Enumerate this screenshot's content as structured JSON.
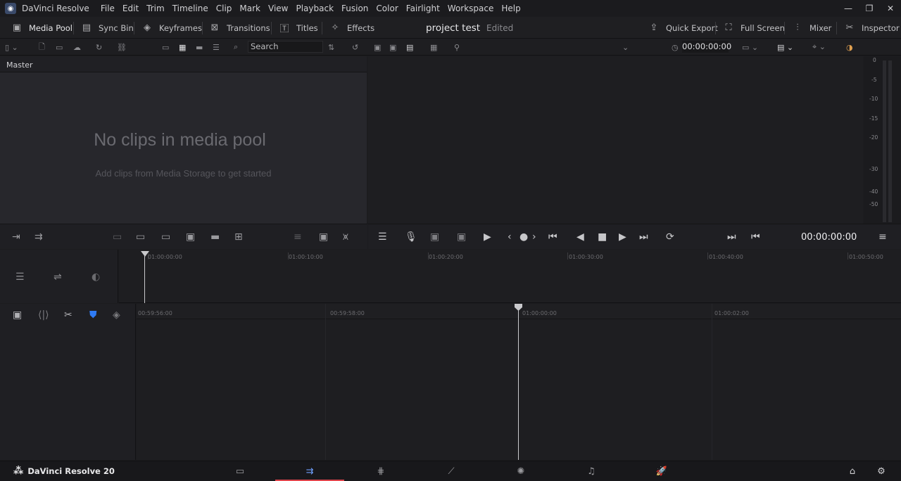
{
  "app": {
    "title": "DaVinci Resolve",
    "logo_icon": "davinci-logo-icon"
  },
  "menu": [
    "File",
    "Edit",
    "Trim",
    "Timeline",
    "Clip",
    "Mark",
    "View",
    "Playback",
    "Fusion",
    "Color",
    "Fairlight",
    "Workspace",
    "Help"
  ],
  "window_controls": {
    "minimize": "—",
    "maximize": "❐",
    "close": "✕"
  },
  "toolbar": {
    "left": [
      {
        "label": "Media Pool",
        "icon": "media-pool-icon"
      },
      {
        "label": "Sync Bin",
        "icon": "sync-bin-icon"
      },
      {
        "label": "Keyframes",
        "icon": "keyframes-icon"
      },
      {
        "label": "Transitions",
        "icon": "transitions-icon"
      },
      {
        "label": "Titles",
        "icon": "titles-icon"
      },
      {
        "label": "Effects",
        "icon": "effects-icon"
      }
    ],
    "project_title": "project test",
    "project_status": "Edited",
    "right": [
      {
        "label": "Quick Export",
        "icon": "quick-export-icon"
      },
      {
        "label": "Full Screen",
        "icon": "full-screen-icon"
      },
      {
        "label": "Mixer",
        "icon": "mixer-icon"
      },
      {
        "label": "Inspector",
        "icon": "inspector-icon"
      }
    ]
  },
  "media_pool": {
    "search_placeholder": "Search",
    "bin": "Master",
    "empty_title": "No clips in media pool",
    "empty_subtitle": "Add clips from Media Storage to get started"
  },
  "viewer": {
    "timecode": "00:00:00:00"
  },
  "audio_meter": {
    "ticks": [
      "0",
      "-5",
      "-10",
      "-15",
      "-20",
      "-30",
      "-40",
      "-50"
    ]
  },
  "transport": {
    "timecode": "00:00:00:00"
  },
  "timeline_upper": {
    "ruler": [
      "01:00:00:00",
      "01:00:10:00",
      "01:00:20:00",
      "01:00:30:00",
      "01:00:40:00",
      "01:00:50:00"
    ]
  },
  "timeline_lower": {
    "ruler": [
      "00:59:56:00",
      "00:59:58:00",
      "01:00:00:00",
      "01:00:02:00"
    ]
  },
  "footer": {
    "brand": "DaVinci Resolve 20"
  },
  "pages": [
    {
      "name": "media",
      "icon": "media-page-icon",
      "active": false
    },
    {
      "name": "cut",
      "icon": "cut-page-icon",
      "active": true
    },
    {
      "name": "edit",
      "icon": "edit-page-icon",
      "active": false
    },
    {
      "name": "fusion",
      "icon": "fusion-page-icon",
      "active": false
    },
    {
      "name": "color",
      "icon": "color-page-icon",
      "active": false
    },
    {
      "name": "fairlight",
      "icon": "fairlight-page-icon",
      "active": false
    },
    {
      "name": "deliver",
      "icon": "deliver-page-icon",
      "active": false
    }
  ],
  "colors": {
    "accent": "#6fa0ff",
    "active_underline": "#e0454b",
    "shield": "#2f7bf5"
  }
}
